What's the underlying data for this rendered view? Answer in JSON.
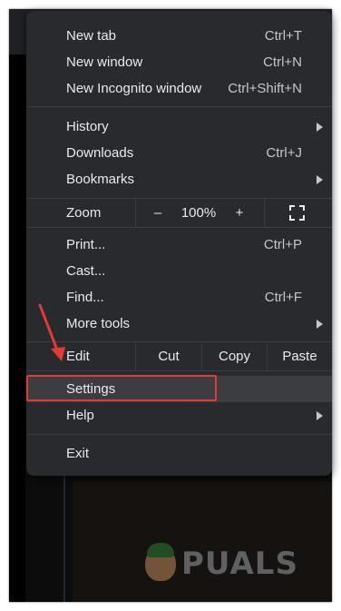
{
  "menu": {
    "new_tab": {
      "label": "New tab",
      "shortcut": "Ctrl+T"
    },
    "new_window": {
      "label": "New window",
      "shortcut": "Ctrl+N"
    },
    "new_incognito": {
      "label": "New Incognito window",
      "shortcut": "Ctrl+Shift+N"
    },
    "history": {
      "label": "History"
    },
    "downloads": {
      "label": "Downloads",
      "shortcut": "Ctrl+J"
    },
    "bookmarks": {
      "label": "Bookmarks"
    },
    "zoom": {
      "label": "Zoom",
      "minus": "–",
      "value": "100%",
      "plus": "+"
    },
    "print": {
      "label": "Print...",
      "shortcut": "Ctrl+P"
    },
    "cast": {
      "label": "Cast..."
    },
    "find": {
      "label": "Find...",
      "shortcut": "Ctrl+F"
    },
    "more_tools": {
      "label": "More tools"
    },
    "edit": {
      "label": "Edit",
      "cut": "Cut",
      "copy": "Copy",
      "paste": "Paste"
    },
    "settings": {
      "label": "Settings"
    },
    "help": {
      "label": "Help"
    },
    "exit": {
      "label": "Exit"
    }
  },
  "watermark": {
    "text": "PUALS"
  },
  "colors": {
    "menu_bg": "#292a2d",
    "text": "#e8eaed",
    "highlight": "#e53935"
  },
  "icons": [
    "submenu-arrow-icon",
    "fullscreen-icon",
    "annotation-arrow-icon"
  ]
}
